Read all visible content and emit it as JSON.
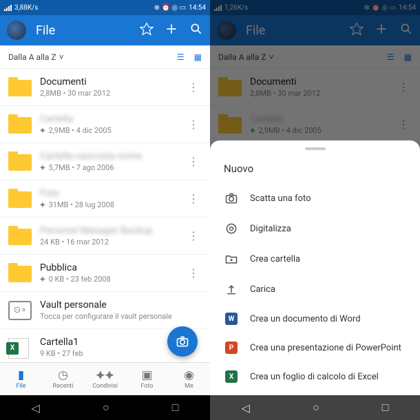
{
  "status": {
    "speed_left": "3,88K/s",
    "speed_right": "1,26K/s",
    "time": "14:54"
  },
  "appbar": {
    "title": "File"
  },
  "sort": {
    "label": "Dalla A alla Z"
  },
  "files": [
    {
      "name": "Documenti",
      "meta": "2,8MB • 30 mar 2012",
      "type": "folder",
      "blur": false
    },
    {
      "name": "Cartella",
      "meta": "2,9MB • 4 dic 2005",
      "type": "folder",
      "blur": true,
      "shared": true
    },
    {
      "name": "Cartella nascosta nome",
      "meta": "5,7MB • 7 ago 2006",
      "type": "folder",
      "blur": true,
      "shared": true
    },
    {
      "name": "Foto",
      "meta": "31MB • 28 lug 2008",
      "type": "folder",
      "blur": true,
      "shared": true
    },
    {
      "name": "Personal Manager Backup",
      "meta": "24 KB • 16 mar 2012",
      "type": "folder",
      "blur": true
    },
    {
      "name": "Pubblica",
      "meta": "0 KB • 23 feb 2008",
      "type": "folder",
      "blur": false,
      "shared": true
    },
    {
      "name": "Vault personale",
      "meta": "Tocca per configurare il vault personale",
      "type": "vault",
      "blur": false
    },
    {
      "name": "Cartella1",
      "meta": "9 KB • 27 feb",
      "type": "excel",
      "blur": false
    }
  ],
  "files_right": [
    {
      "name": "Documenti",
      "meta": "2,8MB • 30 mar 2012",
      "type": "folder"
    },
    {
      "name": "Cartella",
      "meta": "2,9MB • 4 dic 2005",
      "type": "folder",
      "blur": true,
      "shared": true
    }
  ],
  "nav": [
    {
      "label": "File",
      "icon": "folder",
      "active": true
    },
    {
      "label": "Recenti",
      "icon": "clock"
    },
    {
      "label": "Condivisi",
      "icon": "people"
    },
    {
      "label": "Foto",
      "icon": "photo"
    },
    {
      "label": "Me",
      "icon": "person"
    }
  ],
  "sheet": {
    "title": "Nuovo",
    "items": [
      {
        "label": "Scatta una foto",
        "icon": "camera"
      },
      {
        "label": "Digitalizza",
        "icon": "scan"
      },
      {
        "label": "Crea cartella",
        "icon": "newfolder"
      },
      {
        "label": "Carica",
        "icon": "upload"
      },
      {
        "label": "Crea un documento di Word",
        "icon": "word"
      },
      {
        "label": "Crea una presentazione di PowerPoint",
        "icon": "ppt"
      },
      {
        "label": "Crea un foglio di calcolo di Excel",
        "icon": "xls"
      }
    ]
  }
}
